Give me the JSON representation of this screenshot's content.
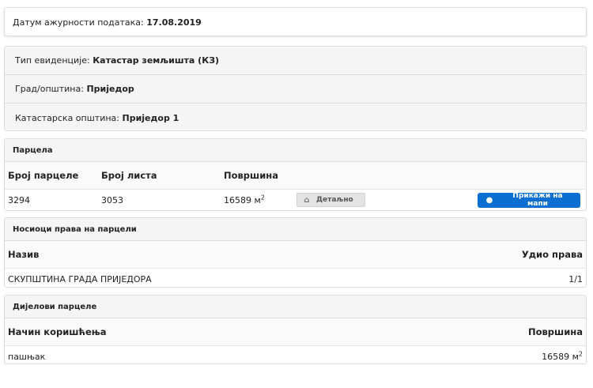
{
  "header": {
    "date_label": "Датум ажурности података:",
    "date_value": "17.08.2019"
  },
  "info": {
    "type_label": "Тип евиденције:",
    "type_value": "Катастар земљишта (КЗ)",
    "city_label": "Град/општина:",
    "city_value": "Приједор",
    "municipality_label": "Катастарска општина:",
    "municipality_value": "Приједор 1"
  },
  "parcel": {
    "title": "Парцела",
    "col_number": "Број парцеле",
    "col_sheet": "Број листа",
    "col_area": "Површина",
    "number": "3294",
    "sheet": "3053",
    "area": "16589",
    "area_unit": "м",
    "area_exp": "2",
    "detail_label": "Детаљно",
    "detail_icon": "home-icon",
    "map_label": "Прикажи на мапи",
    "map_icon": "map-marker-icon",
    "map_color": "#0a6fd0"
  },
  "owners": {
    "title": "Носиоци права на парцели",
    "col_name": "Назив",
    "col_share": "Удио права",
    "rows": [
      {
        "name": "СКУПШТИНА ГРАДА ПРИЈЕДОРА",
        "share": "1/1"
      }
    ]
  },
  "parts": {
    "title": "Дијелови парцеле",
    "col_use": "Начин коришћења",
    "col_area": "Површина",
    "rows": [
      {
        "use": "пашњак",
        "area": "16589",
        "unit": "м",
        "exp": "2"
      }
    ]
  }
}
